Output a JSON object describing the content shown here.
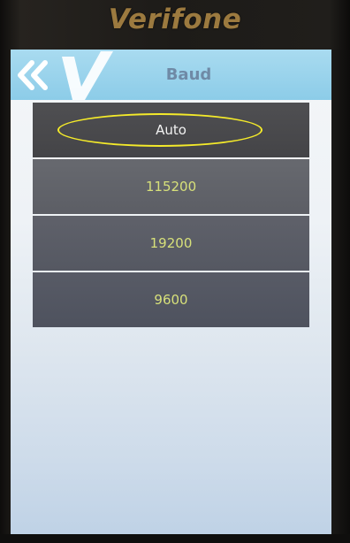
{
  "device": {
    "brand": "Verifone"
  },
  "header": {
    "title": "Baud",
    "back_icon": "double-chevron-left-icon",
    "logo_icon": "verifone-v-logo-icon"
  },
  "menu": {
    "selected_index": 0,
    "items": [
      {
        "label": "Auto",
        "selected": true
      },
      {
        "label": "115200",
        "selected": false
      },
      {
        "label": "19200",
        "selected": false
      },
      {
        "label": "9600",
        "selected": false
      }
    ]
  },
  "colors": {
    "brand_text": "#9c7a3f",
    "titlebar": "#9fd6ee",
    "title_text": "#6f8aa6",
    "item_text": "#d7e07a",
    "selected_text": "#f2f2f2",
    "highlight_ring": "#f4ea2a"
  }
}
